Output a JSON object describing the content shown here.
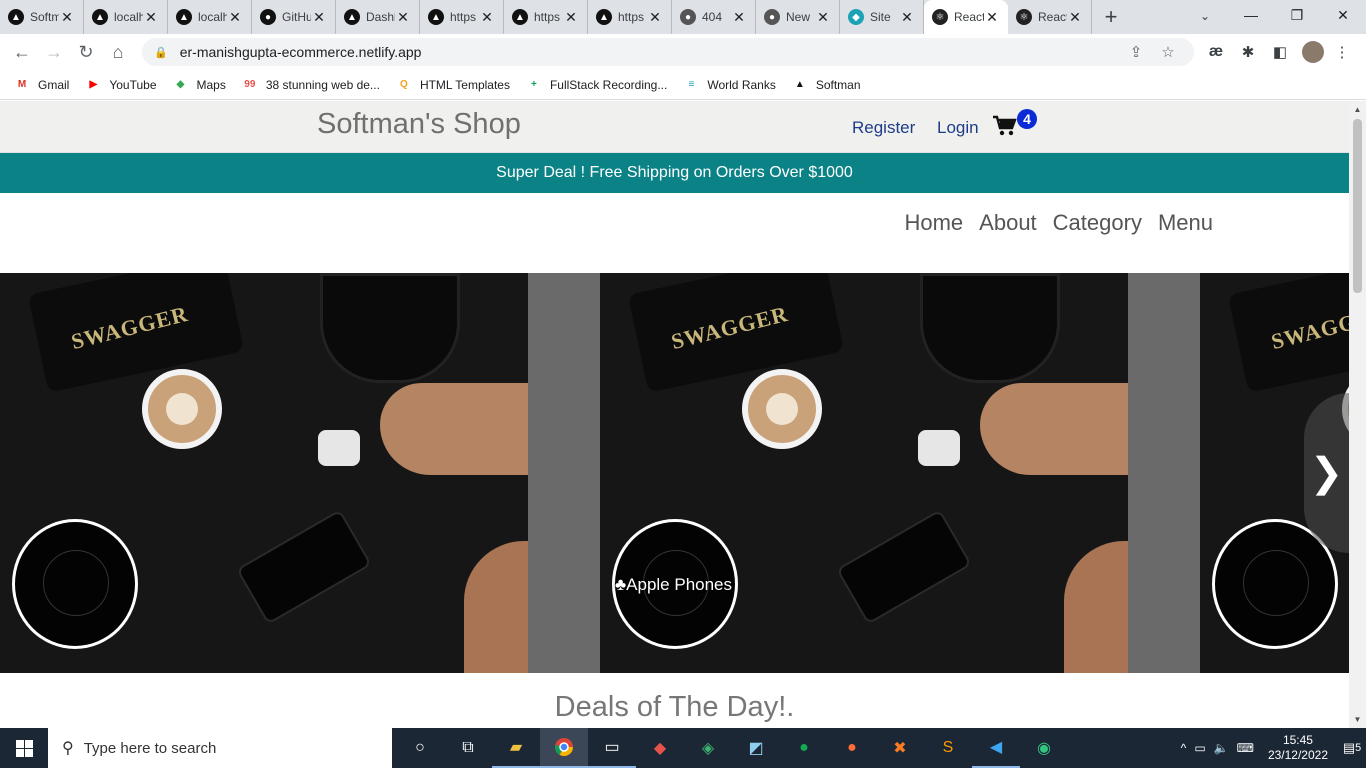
{
  "browser": {
    "tabs": [
      {
        "title": "Softman",
        "fav": "▲",
        "favcolor": "#111"
      },
      {
        "title": "localhost",
        "fav": "▲",
        "favcolor": "#111"
      },
      {
        "title": "localhost",
        "fav": "▲",
        "favcolor": "#111"
      },
      {
        "title": "GitHub",
        "fav": "●",
        "favcolor": "#111"
      },
      {
        "title": "Dashboard",
        "fav": "▲",
        "favcolor": "#111"
      },
      {
        "title": "https",
        "fav": "▲",
        "favcolor": "#111"
      },
      {
        "title": "https",
        "fav": "▲",
        "favcolor": "#111"
      },
      {
        "title": "https",
        "fav": "▲",
        "favcolor": "#111"
      },
      {
        "title": "404",
        "fav": "●",
        "favcolor": "#555"
      },
      {
        "title": "New",
        "fav": "●",
        "favcolor": "#555"
      },
      {
        "title": "Site",
        "fav": "◆",
        "favcolor": "#1ba3b5"
      },
      {
        "title": "React",
        "fav": "⚛",
        "favcolor": "#222"
      },
      {
        "title": "React",
        "fav": "⚛",
        "favcolor": "#222"
      }
    ],
    "active_tab_index": 11,
    "url": "er-manishgupta-ecommerce.netlify.app",
    "bookmarks": [
      {
        "label": "Gmail",
        "icon": "M",
        "color": "#d93025"
      },
      {
        "label": "YouTube",
        "icon": "▶",
        "color": "#ff0000"
      },
      {
        "label": "Maps",
        "icon": "◆",
        "color": "#34a853"
      },
      {
        "label": "38 stunning web de...",
        "icon": "99",
        "color": "#e5534b"
      },
      {
        "label": "HTML Templates",
        "icon": "Q",
        "color": "#f4a020"
      },
      {
        "label": "FullStack Recording...",
        "icon": "+",
        "color": "#0f9d58"
      },
      {
        "label": "World Ranks",
        "icon": "≡",
        "color": "#1ba3b5"
      },
      {
        "label": "Softman",
        "icon": "▲",
        "color": "#111"
      }
    ]
  },
  "site": {
    "logo": "Softman's Shop",
    "register": "Register",
    "login": "Login",
    "cart_count": "4",
    "promo": "Super Deal ! Free Shipping on Orders Over $1000",
    "nav": [
      "Home",
      "About",
      "Category",
      "Menu"
    ],
    "slide_caption": "♣Apple Phones",
    "slide_brand": "SWAGGER",
    "next_arrow": "❯",
    "deals_heading": "Deals of The Day!."
  },
  "taskbar": {
    "search_placeholder": "Type here to search",
    "time": "15:45",
    "date": "23/12/2022",
    "notifications": "5"
  }
}
